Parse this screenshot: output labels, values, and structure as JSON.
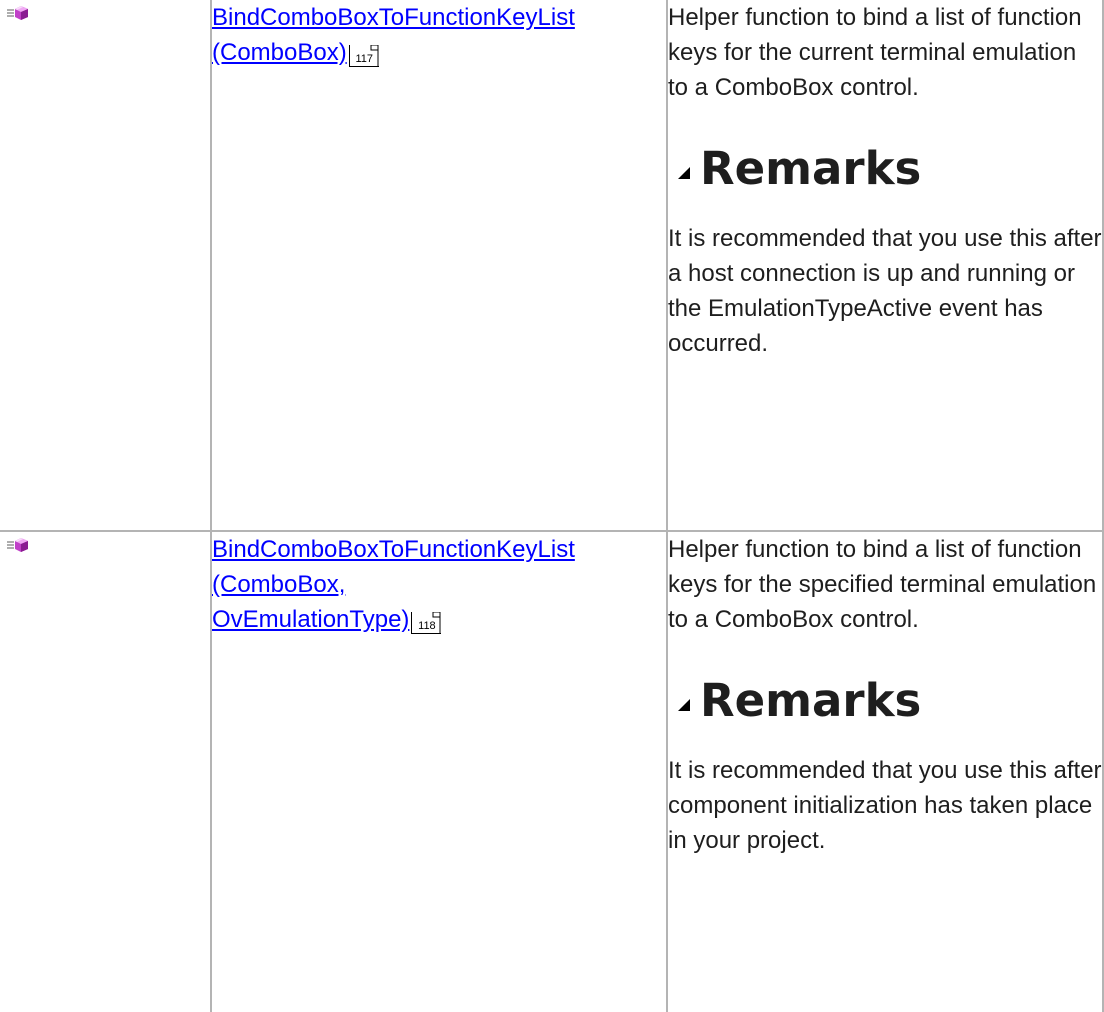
{
  "rows": [
    {
      "icon": "public-method-icon",
      "name_line1": "BindComboBoxToFunctionKeyList",
      "name_line2": "(ComboBox)",
      "name_line3": "",
      "page_ref": "117",
      "description": "Helper function to bind a list of function keys for the current terminal emulation to a ComboBox control.",
      "remarks_heading": "Remarks",
      "remarks_text": "It is recommended that you use this after a host connection is up and running or the EmulationTypeActive event has occurred."
    },
    {
      "icon": "public-method-icon",
      "name_line1": "BindComboBoxToFunctionKeyList",
      "name_line2": "(ComboBox,",
      "name_line3": "OvEmulationType)",
      "page_ref": "118",
      "description": "Helper function to bind a list of function keys for the specified terminal emulation to a ComboBox control.",
      "remarks_heading": "Remarks",
      "remarks_text": "It is recommended that you use this after component initialization has taken place in your project."
    }
  ],
  "colors": {
    "link": "#0000ff",
    "border": "#b4b4b4",
    "text": "#1e1e1e"
  }
}
